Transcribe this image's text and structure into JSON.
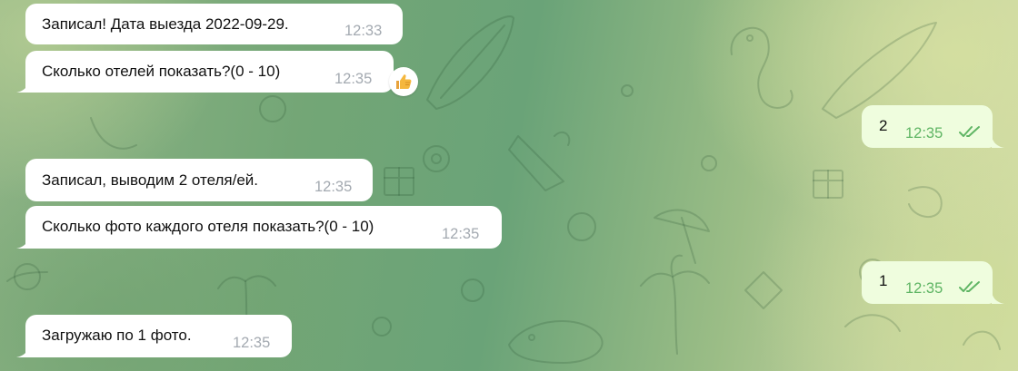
{
  "messages": [
    {
      "direction": "in",
      "text": "Записал! Дата выезда 2022-09-29.",
      "time": "12:33"
    },
    {
      "direction": "in",
      "text": "Сколько отелей показать?(0 - 10)",
      "time": "12:35",
      "reaction": "thumbs-up-icon"
    },
    {
      "direction": "out",
      "text": "2",
      "time": "12:35",
      "status": "read"
    },
    {
      "direction": "in",
      "text": "Записал, выводим 2 отеля/ей.",
      "time": "12:35"
    },
    {
      "direction": "in",
      "text": "Сколько фото каждого отеля показать?(0 - 10)",
      "time": "12:35"
    },
    {
      "direction": "out",
      "text": "1",
      "time": "12:35",
      "status": "read"
    },
    {
      "direction": "in",
      "text": "Загружаю по 1 фото.",
      "time": "12:35"
    }
  ],
  "colors": {
    "incoming_bubble": "#ffffff",
    "outgoing_bubble": "#effdde",
    "time_incoming": "#a4aab1",
    "time_outgoing": "#5fb564",
    "read_ticks": "#5fb564"
  }
}
